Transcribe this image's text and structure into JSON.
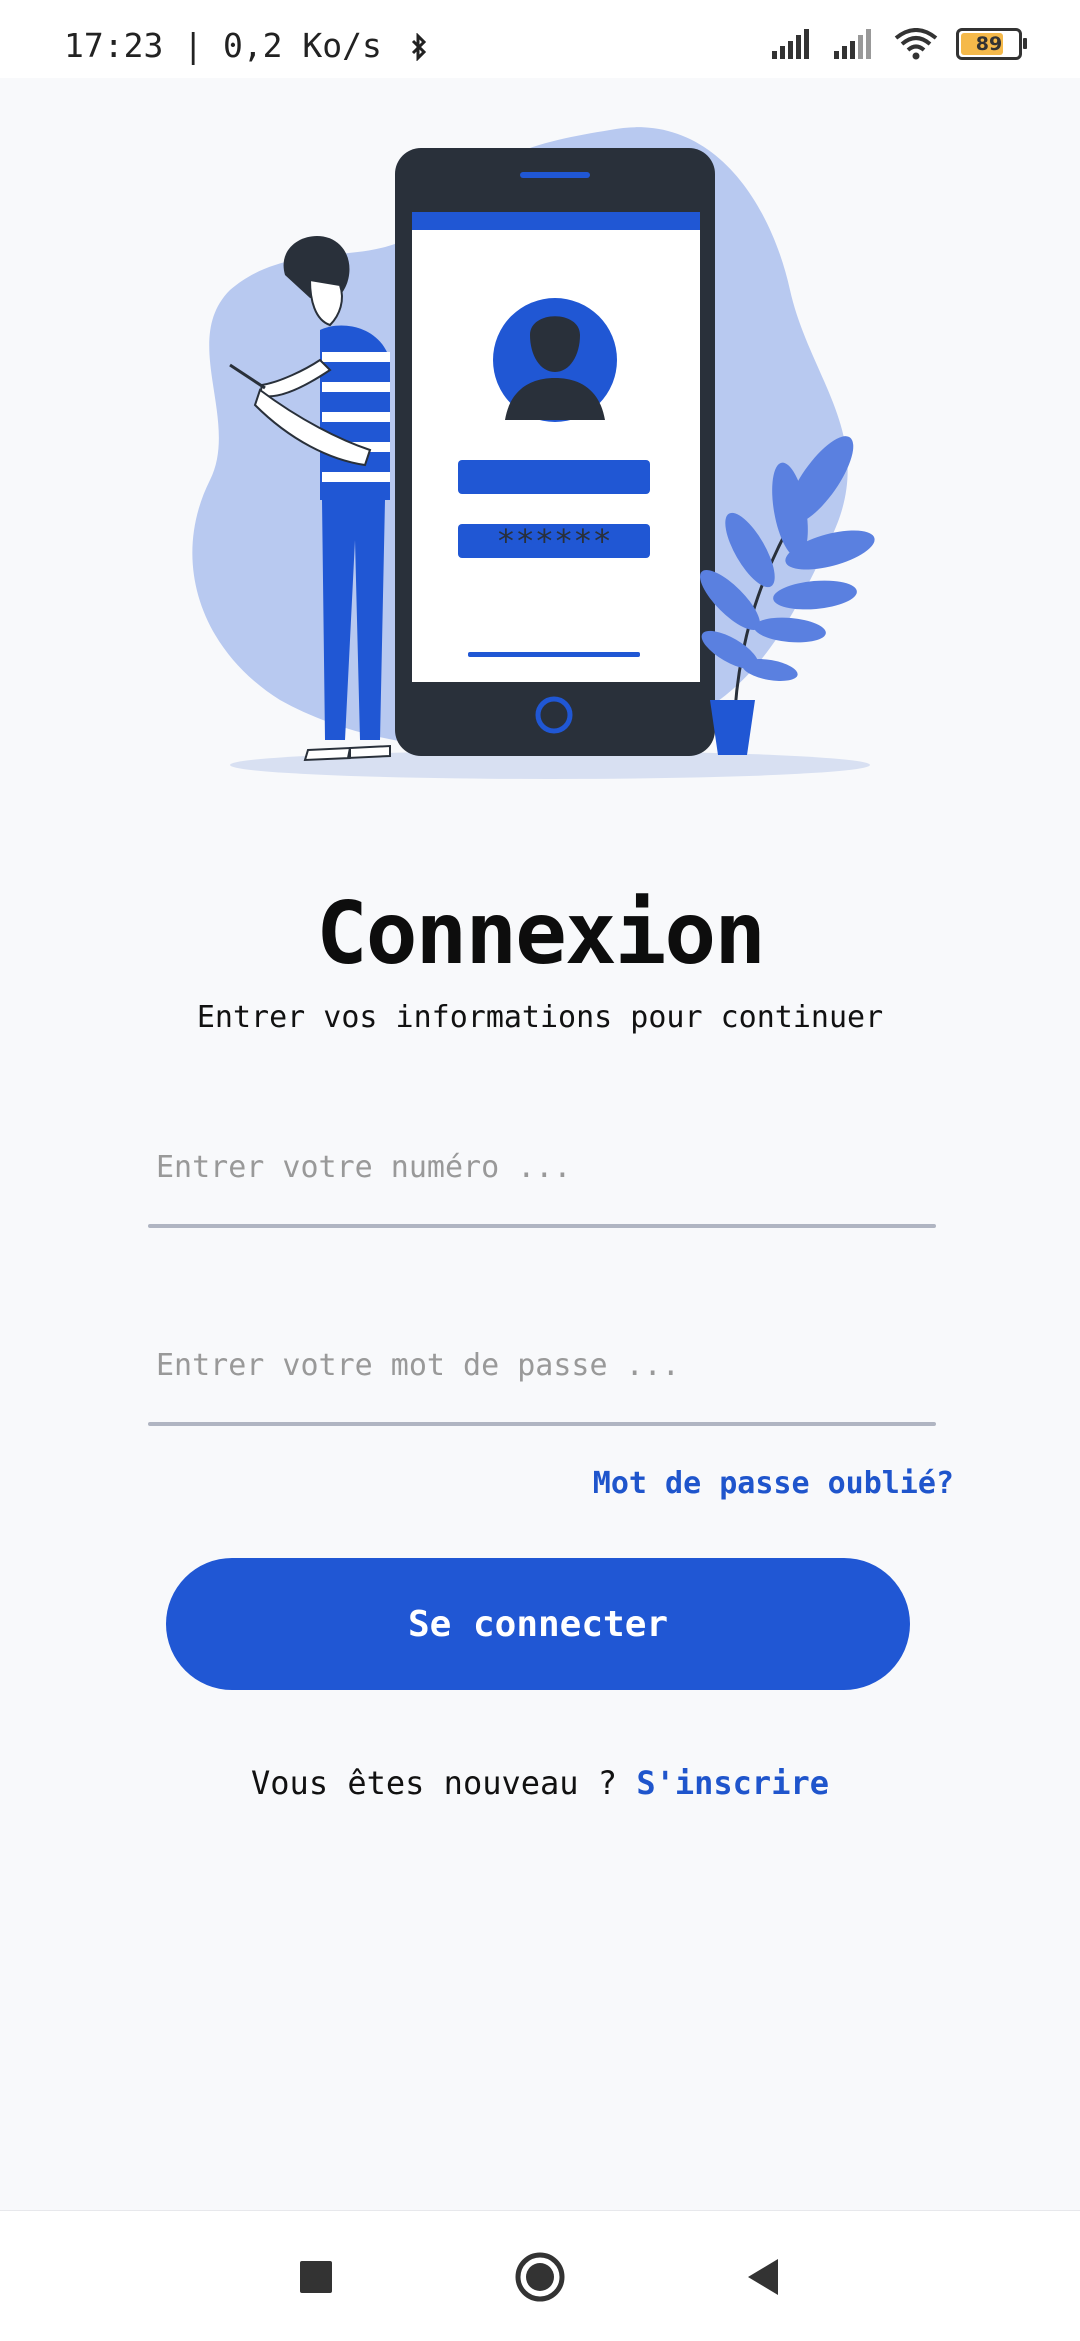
{
  "status_bar": {
    "time_network": "17:23 | 0,2 Ko/s",
    "battery_level": "89"
  },
  "login": {
    "title": "Connexion",
    "subtitle": "Entrer vos informations pour continuer",
    "phone_placeholder": "Entrer votre numéro ...",
    "password_placeholder": "Entrer votre mot de passe ...",
    "forgot_password": "Mot de passe oublié?",
    "submit_label": "Se connecter",
    "signup_prompt": "Vous êtes nouveau ?",
    "signup_link": "S'inscrire"
  },
  "illustration": {
    "password_mask": "******"
  },
  "colors": {
    "accent": "#2057d4",
    "link": "#1f55cc",
    "background": "#f8f9fb"
  },
  "icons": [
    "bluetooth-icon",
    "signal-icon",
    "wifi-icon",
    "battery-icon",
    "recent-apps-icon",
    "home-icon",
    "back-icon"
  ]
}
